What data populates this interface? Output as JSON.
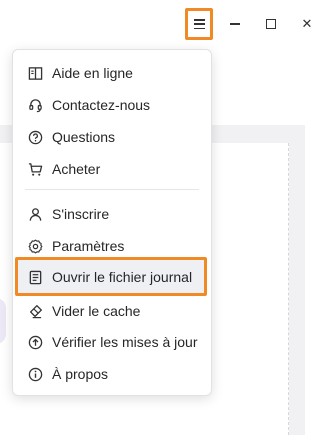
{
  "menu": {
    "items": [
      {
        "label": "Aide en ligne",
        "icon": "book-icon"
      },
      {
        "label": "Contactez-nous",
        "icon": "headset-icon"
      },
      {
        "label": "Questions",
        "icon": "question-circle-icon"
      },
      {
        "label": "Acheter",
        "icon": "cart-icon"
      },
      {
        "label": "S'inscrire",
        "icon": "user-icon"
      },
      {
        "label": "Paramètres",
        "icon": "gear-icon"
      },
      {
        "label": "Ouvrir le fichier journal",
        "icon": "log-file-icon"
      },
      {
        "label": "Vider le cache",
        "icon": "eraser-icon"
      },
      {
        "label": "Vérifier les mises à jour",
        "icon": "upload-circle-icon"
      },
      {
        "label": "À propos",
        "icon": "info-circle-icon"
      }
    ],
    "highlighted_item": "Ouvrir le fichier journal"
  },
  "window_controls": {
    "menu": "hamburger-icon",
    "minimize": "minimize-icon",
    "maximize": "maximize-icon",
    "close": "close-icon",
    "close_glyph": "✕"
  },
  "colors": {
    "highlight_border": "#f08a24",
    "text": "#262626",
    "hover_bg": "#eef0f4"
  }
}
